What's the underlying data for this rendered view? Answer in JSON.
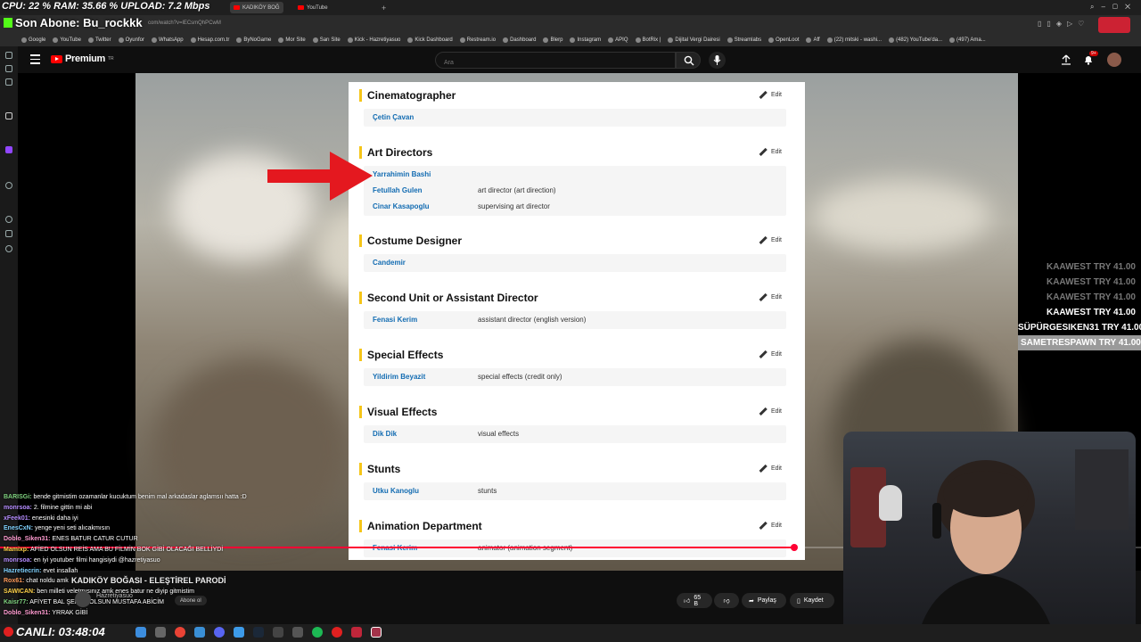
{
  "overlay": {
    "stats": "CPU: 22 % RAM:  35.66 % UPLOAD: 7.2 Mbps",
    "last_subscriber": "Son Abone: Bu_rockkk"
  },
  "browser": {
    "tabs": [
      {
        "label": "KADIKÖY BOĞ"
      },
      {
        "label": "YouTube"
      }
    ],
    "url": "com/watch?v=lECsmQhPCwM",
    "bookmarks": [
      "Google",
      "YouTube",
      "Twitter",
      "Oyunfor",
      "WhatsApp",
      "Hesap.com.tr",
      "ByNoGame",
      "Mor Site",
      "Sarı Site",
      "Kick - Hazretiyasuo",
      "Kick Dashboard",
      "Restream.io",
      "Dashboard",
      "Blerp",
      "Instagram",
      "APIQ",
      "BotRix |",
      "Dijital Vergi Dairesi",
      "Streamlabs",
      "OpenLoot",
      "Aff",
      "(22) mitski - washi...",
      "(482) YouTube'da...",
      "(497) Ama..."
    ]
  },
  "youtube": {
    "logo_text": "Premium",
    "logo_sup": "TR",
    "search_placeholder": "Ara",
    "notifications_badge": "9+"
  },
  "imdb": {
    "edit_label": "Edit",
    "sections": [
      {
        "title": "Cinematographer",
        "rows": [
          {
            "name": "Çetin Çavan",
            "role": ""
          }
        ]
      },
      {
        "title": "Art Directors",
        "rows": [
          {
            "name": "Yarrahimin Bashi",
            "role": ""
          },
          {
            "name": "Fetullah Gulen",
            "role": "art director (art direction)"
          },
          {
            "name": "Cinar Kasapoglu",
            "role": "supervising art director"
          }
        ]
      },
      {
        "title": "Costume Designer",
        "rows": [
          {
            "name": "Candemir",
            "role": ""
          }
        ]
      },
      {
        "title": "Second Unit or Assistant Director",
        "rows": [
          {
            "name": "Fenasi Kerim",
            "role": "assistant director (english version)"
          }
        ]
      },
      {
        "title": "Special Effects",
        "rows": [
          {
            "name": "Yildirim Beyazit",
            "role": "special effects (credit only)"
          }
        ]
      },
      {
        "title": "Visual Effects",
        "rows": [
          {
            "name": "Dik Dik",
            "role": "visual effects"
          }
        ]
      },
      {
        "title": "Stunts",
        "rows": [
          {
            "name": "Utku Kanoglu",
            "role": "stunts"
          }
        ]
      },
      {
        "title": "Animation Department",
        "rows": [
          {
            "name": "Fenasi Kerim",
            "role": "animator (animation segment)"
          }
        ]
      }
    ]
  },
  "chat": [
    {
      "user": "BARISGi:",
      "msg": "bende gitmistim ozamanlar kucuktum benim mal arkadaslar aglamsıı hatta :D",
      "color": "#7fd27f"
    },
    {
      "user": "monrsoa:",
      "msg": "2. filmine gittin mi abi",
      "color": "#b58cff"
    },
    {
      "user": "xFeek01:",
      "msg": "enesinki daha iyi",
      "color": "#b58cff"
    },
    {
      "user": "EnesCxN:",
      "msg": "yenge yeni seti alıcakmısın",
      "color": "#7fd2ff"
    },
    {
      "user": "Doblo_Siken31:",
      "msg": "ENES BATUR CATUR CUTUR",
      "color": "#ff9bd0"
    },
    {
      "user": "Mamixp:",
      "msg": "AFİED OLSUN REİS AMA BU FİLMİN BOK GİBİ OLACAĞI BELLİYDİ",
      "color": "#ffd24a"
    },
    {
      "user": "monrsoa:",
      "msg": "en iyi youtuber filmi hangisiydi @hazretiyasuo",
      "color": "#b58cff"
    },
    {
      "user": "Hazretiecrin:",
      "msg": "evet insallah",
      "color": "#7fd2ff"
    },
    {
      "user": "Rox61:",
      "msg": "chat noldu amk",
      "color": "#ff9b5a"
    },
    {
      "user": "SAWICAN:",
      "msg": "ben milleti veletmısınız amk enes batur ne diyip gitmistim",
      "color": "#ffd24a"
    },
    {
      "user": "Kaisr77:",
      "msg": "AFİYET BAL ŞEKER OLSUN MUSTAFA ABİCİM",
      "color": "#7fd27f"
    },
    {
      "user": "Doblo_Siken31:",
      "msg": "YRRAK GİBİ",
      "color": "#ff9bd0"
    }
  ],
  "video": {
    "title": "KADIKÖY BOĞASI - ELEŞTİREL PARODİ",
    "channel": "Hazretiyasuo",
    "subscribe_label": "Abone ol",
    "likes": "65 B",
    "share_label": "Paylaş",
    "save_label": "Kaydet",
    "progress": 0.696
  },
  "donations": [
    {
      "text": "KAAWEST  TRY 41.00",
      "style": "dim"
    },
    {
      "text": "KAAWEST  TRY 41.00",
      "style": "dim"
    },
    {
      "text": "KAAWEST  TRY 41.00",
      "style": "dim"
    },
    {
      "text": "KAAWEST  TRY 41.00",
      "style": "hi"
    },
    {
      "text": "SÜPÜRGESIKEN31  TRY 41.00",
      "style": "hi"
    },
    {
      "text": "SAMETRESPAWN  TRY 41.00",
      "style": "sel"
    }
  ],
  "live": {
    "label": "CANLI: 03:48:04"
  },
  "colors": {
    "accent_red": "#ff0033",
    "imdb_yellow": "#f5c518",
    "imdb_link": "#136cb2"
  }
}
